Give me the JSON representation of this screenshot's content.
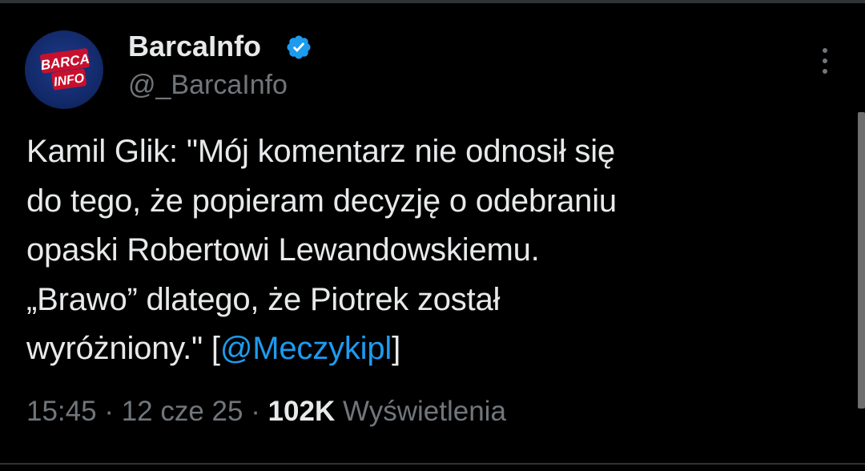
{
  "author": {
    "display_name": "BarcaInfo",
    "handle": "@_BarcaInfo",
    "verified": true,
    "avatar_text_top": "BARCA",
    "avatar_text_bottom": "INFO"
  },
  "tweet": {
    "line1": "Kamil Glik: \"Mój komentarz nie odnosił się",
    "line2": "do tego, że popieram decyzję o odebraniu",
    "line3": "opaski Robertowi Lewandowskiemu.",
    "line4": "„Brawo” dlatego, że Piotrek został",
    "line5_prefix": "wyróżniony.\" [",
    "mention": "@Meczykipl",
    "line5_suffix": "]"
  },
  "meta": {
    "time": "15:45",
    "sep1": " · ",
    "date": "12 cze 25",
    "sep2": " · ",
    "views_count": "102K",
    "views_label": " Wyświetlenia"
  },
  "icons": {
    "more": "more-vertical-icon",
    "verified": "verified-badge-icon"
  },
  "colors": {
    "background": "#000000",
    "text": "#e7e9ea",
    "secondary_text": "#71767b",
    "link": "#1d9bf0",
    "verified": "#1d9bf0"
  }
}
